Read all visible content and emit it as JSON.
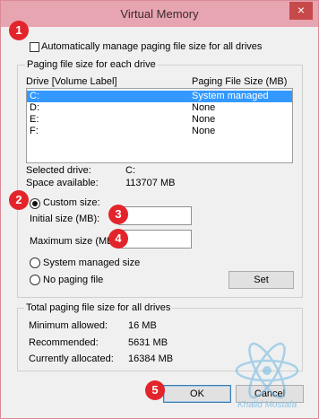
{
  "window": {
    "title": "Virtual Memory",
    "close_glyph": "×"
  },
  "auto_manage": {
    "label": "Automatically manage paging file size for all drives",
    "checked": false
  },
  "drives_group": {
    "title": "Paging file size for each drive",
    "col_drive": "Drive  [Volume Label]",
    "col_size": "Paging File Size (MB)",
    "rows": [
      {
        "drive": "C:",
        "size": "System managed",
        "selected": true
      },
      {
        "drive": "D:",
        "size": "None",
        "selected": false
      },
      {
        "drive": "E:",
        "size": "None",
        "selected": false
      },
      {
        "drive": "F:",
        "size": "None",
        "selected": false
      }
    ],
    "selected_drive_label": "Selected drive:",
    "selected_drive_value": "C:",
    "space_available_label": "Space available:",
    "space_available_value": "113707 MB",
    "custom_size_label": "Custom size:",
    "initial_size_label": "Initial size (MB):",
    "initial_size_value": "",
    "maximum_size_label": "Maximum size (MB):",
    "maximum_size_value": "",
    "system_managed_label": "System managed size",
    "no_paging_label": "No paging file",
    "set_label": "Set"
  },
  "totals_group": {
    "title": "Total paging file size for all drives",
    "min_label": "Minimum allowed:",
    "min_value": "16 MB",
    "rec_label": "Recommended:",
    "rec_value": "5631 MB",
    "cur_label": "Currently allocated:",
    "cur_value": "16384 MB"
  },
  "buttons": {
    "ok": "OK",
    "cancel": "Cancel"
  },
  "steps": [
    "1",
    "2",
    "3",
    "4",
    "5"
  ],
  "watermark": {
    "text": "Khalid Mostafa",
    "icon": "atom-icon"
  },
  "colors": {
    "titlebar": "#e7a4b1",
    "selection": "#3399ff",
    "step_badge": "#e3242b"
  }
}
